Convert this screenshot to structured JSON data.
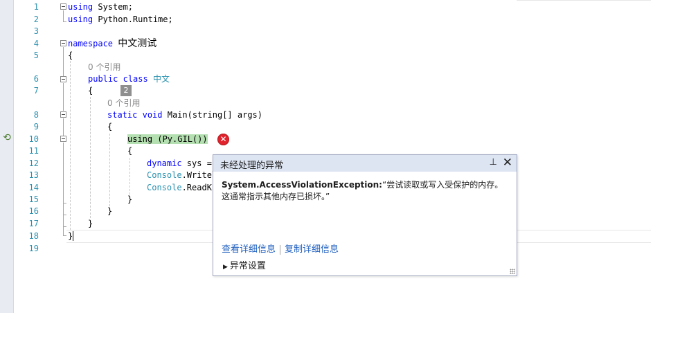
{
  "editor": {
    "line_numbers": [
      "1",
      "2",
      "3",
      "4",
      "5",
      "6",
      "7",
      "8",
      "9",
      "10",
      "11",
      "12",
      "13",
      "14",
      "15",
      "16",
      "17",
      "18",
      "19"
    ],
    "lines": {
      "l1": {
        "kw": "using",
        "rest": " System;"
      },
      "l2": {
        "kw": "using",
        "rest": " Python.Runtime;"
      },
      "l4": {
        "kw": "namespace",
        "name": "中文测试"
      },
      "l5": "{",
      "codelens_class": "0 个引用",
      "l6": {
        "kw1": "public",
        "kw2": "class",
        "name": "中文"
      },
      "l7": "{",
      "badge": "2",
      "codelens_main": "0 个引用",
      "l8": {
        "kw1": "static",
        "kw2": "void",
        "rest": " Main(string[] args)"
      },
      "l9": "{",
      "l10": "using (Py.GIL())",
      "l11": "{",
      "l12": {
        "kw": "dynamic",
        "rest": " sys ="
      },
      "l13": {
        "ty": "Console",
        "rest": ".Writel"
      },
      "l14": {
        "ty": "Console",
        "rest": ".ReadK("
      },
      "l15": "}",
      "l16": "}",
      "l17": "}",
      "l18": "}"
    }
  },
  "exception_popup": {
    "title": "未经处理的异常",
    "exception_type": "System.AccessViolationException:",
    "message_line1": "“尝试读取或写入受保护的内存。",
    "message_line2": "这通常指示其他内存已损坏。”",
    "link_view_details": "查看详细信息",
    "link_copy_details": "复制详细信息",
    "settings_label": "异常设置"
  },
  "icons": {
    "pin": "pin-icon",
    "close": "close-icon",
    "error": "error-icon",
    "execution": "execution-pointer-icon"
  },
  "colors": {
    "keyword": "#0000ff",
    "type": "#2b91af",
    "line_number": "#2b91af",
    "highlight": "#b4dfb0",
    "error": "#e0232c",
    "popup_header": "#dde4f2",
    "link": "#1f5fbf"
  }
}
